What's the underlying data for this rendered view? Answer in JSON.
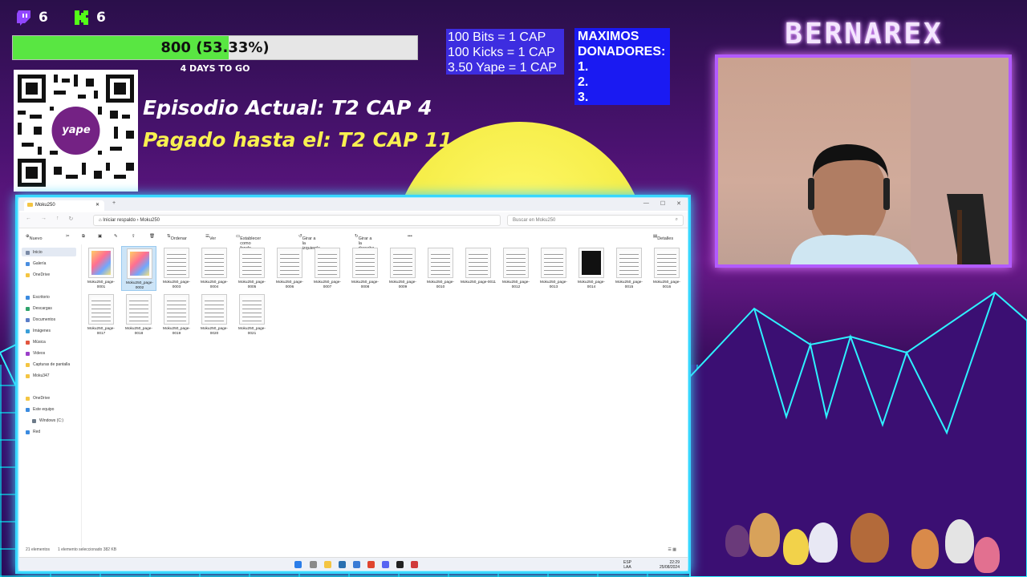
{
  "stream": {
    "twitch_count": "6",
    "kick_count": "6",
    "goal_text": "800 (53.33%)",
    "goal_progress_pct": 53.33,
    "days_to_go": "4 DAYS TO GO",
    "episode_current": "Episodio Actual: T2 CAP 4",
    "episode_paid": "Pagado hasta el: T2 CAP 11",
    "rates": [
      "100 Bits = 1 CAP",
      "100 Kicks = 1 CAP",
      "3.50 Yape = 1 CAP"
    ],
    "donors_title_1": "MAXIMOS",
    "donors_title_2": "DONADORES:",
    "donors": [
      "1.",
      "2.",
      "3."
    ],
    "logo": "BERNAREX",
    "qr_label": "yape"
  },
  "explorer": {
    "tab_title": "Moku250",
    "address_start": "Iniciar respaldo",
    "address_folder": "Moku250",
    "search_placeholder": "Buscar en Moku250",
    "toolbar": {
      "new": "Nuevo",
      "order": "Ordenar",
      "view": "Ver",
      "set_bg": "Establecer como fondo",
      "rotate_left": "Girar a la izquierda",
      "rotate_right": "Girar a la derecha",
      "more": "•••",
      "details": "Detalles"
    },
    "sidebar": {
      "home": "Inicio",
      "gallery": "Galería",
      "onedrive1": "OneDrive",
      "desktop": "Escritorio",
      "downloads": "Descargas",
      "documents": "Documentos",
      "images": "Imágenes",
      "music": "Música",
      "videos": "Videos",
      "captures": "Capturas de pantalla",
      "moku": "Moku347",
      "onedrive2": "OneDrive",
      "this_pc": "Este equipo",
      "windows": "Windows (C:)",
      "network": "Red"
    },
    "files": [
      {
        "name": "Moku250_page-0001",
        "kind": "color"
      },
      {
        "name": "Moku250_page-0002",
        "kind": "color"
      },
      {
        "name": "Moku250_page-0003",
        "kind": "manga"
      },
      {
        "name": "Moku250_page-0004",
        "kind": "manga"
      },
      {
        "name": "Moku250_page-0005",
        "kind": "manga"
      },
      {
        "name": "Moku250_page-0006",
        "kind": "manga"
      },
      {
        "name": "Moku250_page-0007",
        "kind": "manga"
      },
      {
        "name": "Moku250_page-0008",
        "kind": "manga"
      },
      {
        "name": "Moku250_page-0009",
        "kind": "manga"
      },
      {
        "name": "Moku250_page-0010",
        "kind": "manga"
      },
      {
        "name": "Moku250_page-0011",
        "kind": "manga"
      },
      {
        "name": "Moku250_page-0012",
        "kind": "manga"
      },
      {
        "name": "Moku250_page-0013",
        "kind": "manga"
      },
      {
        "name": "Moku250_page-0014",
        "kind": "dark"
      },
      {
        "name": "Moku250_page-0015",
        "kind": "manga"
      },
      {
        "name": "Moku250_page-0016",
        "kind": "manga"
      },
      {
        "name": "Moku250_page-0017",
        "kind": "manga"
      },
      {
        "name": "Moku250_page-0018",
        "kind": "manga"
      },
      {
        "name": "Moku250_page-0019",
        "kind": "manga"
      },
      {
        "name": "Moku250_page-0020",
        "kind": "manga"
      },
      {
        "name": "Moku250_page-0021",
        "kind": "manga"
      }
    ],
    "selected_index": 1,
    "status_count": "21 elementos",
    "status_selection": "1 elemento seleccionado  382 KB",
    "taskbar": {
      "lang_1": "ESP",
      "lang_2": "LAA",
      "time": "22:29",
      "date": "25/08/2024"
    }
  },
  "colors": {
    "progress_fill": "#59e642",
    "window_glow": "#38d7ff",
    "webcam_border": "#b25bff",
    "rates_bg": "#3d2de0",
    "donors_bg": "#1a1af2",
    "episode_current": "#ffffff",
    "episode_paid": "#f8f050"
  }
}
